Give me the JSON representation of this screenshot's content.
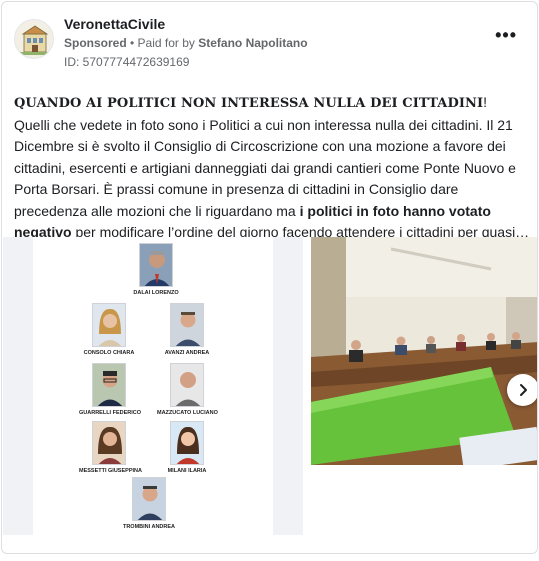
{
  "post": {
    "page_name": "VeronettaCivile",
    "sponsored": "Sponsored",
    "paid_for_prefix": " • Paid for by ",
    "paid_for_name": "Stefano Napolitano",
    "ad_id": "ID: 5707774472639169",
    "more_label": "•••"
  },
  "body": {
    "headline": "QUANDO AI POLITICI NON INTERESSA NULLA DEI CITTADINI",
    "headline_end": "!",
    "text_part1": "Quelli che vedete in foto sono i Politici a cui non interessa nulla dei cittadini. Il 21 Dicembre si è svolto il Consiglio di Circoscrizione con una mozione a favore dei cittadini, esercenti e artigiani danneggiati dai grandi cantieri come Ponte Nuovo e Porta Borsari. È prassi comune in presenza di cittadini in Consiglio dare precedenza alle mozioni che li riguardano ma ",
    "text_bold": "i politici in foto hanno votato negativo",
    "text_part2": " per modificare l’ordine del giorno facendo attendere i cittadini per quasi…"
  },
  "carousel": {
    "politicians": [
      {
        "name": "DALAI LORENZO"
      },
      {
        "name": "CONSOLO CHIARA"
      },
      {
        "name": "AVANZI ANDREA"
      },
      {
        "name": "GUARRELLI FEDERICO"
      },
      {
        "name": "MAZZUCATO LUCIANO"
      },
      {
        "name": "MESSETTI GIUSEPPINA"
      },
      {
        "name": "MILANI ILARIA"
      },
      {
        "name": "TROMBINI ANDREA"
      }
    ],
    "next_icon": "chevron-right-icon"
  }
}
